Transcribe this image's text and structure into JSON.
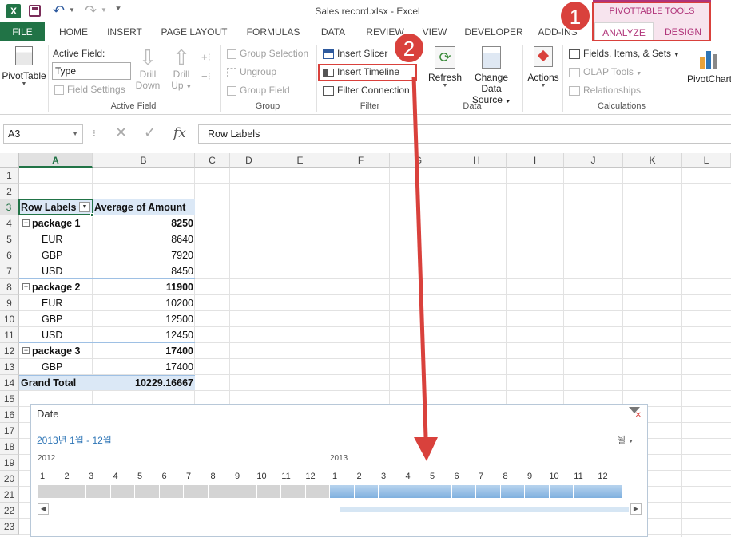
{
  "window": {
    "title": "Sales record.xlsx - Excel"
  },
  "context_tab_group": "PIVOTTABLE TOOLS",
  "tabs": [
    "FILE",
    "HOME",
    "INSERT",
    "PAGE LAYOUT",
    "FORMULAS",
    "DATA",
    "REVIEW",
    "VIEW",
    "DEVELOPER",
    "ADD-INS",
    "ANALYZE",
    "DESIGN"
  ],
  "ribbon": {
    "pivottable": {
      "label": "PivotTable"
    },
    "active_field": {
      "label": "Active Field:",
      "value": "Type",
      "field_settings": "Field Settings",
      "drill_down": [
        "Drill",
        "Down"
      ],
      "drill_up": [
        "Drill",
        "Up"
      ],
      "group_label": "Active Field"
    },
    "group": {
      "group_selection": "Group Selection",
      "ungroup": "Ungroup",
      "group_field": "Group Field",
      "group_label": "Group"
    },
    "filter": {
      "insert_slicer": "Insert Slicer",
      "insert_timeline": "Insert Timeline",
      "filter_connections": "Filter Connection",
      "group_label": "Filter"
    },
    "data": {
      "refresh": "Refresh",
      "change_source": [
        "Change Data",
        "Source"
      ],
      "group_label": "Data"
    },
    "actions": {
      "label": "Actions"
    },
    "calculations": {
      "fields_items": "Fields, Items, & Sets",
      "olap": "OLAP Tools",
      "relationships": "Relationships",
      "group_label": "Calculations"
    },
    "pivotchart": {
      "label": "PivotChart"
    }
  },
  "callouts": [
    "1",
    "2"
  ],
  "formula_bar": {
    "name_box": "A3",
    "fx": "fx",
    "content": "Row Labels"
  },
  "columns": [
    "A",
    "B",
    "C",
    "D",
    "E",
    "F",
    "G",
    "H",
    "I",
    "J",
    "K",
    "L"
  ],
  "rows": [
    "1",
    "2",
    "3",
    "4",
    "5",
    "6",
    "7",
    "8",
    "9",
    "10",
    "11",
    "12",
    "13",
    "14",
    "15",
    "16",
    "17",
    "18",
    "19",
    "20",
    "21",
    "22",
    "23"
  ],
  "pivot": {
    "header": {
      "labels": "Row Labels",
      "values": "Average of Amount"
    },
    "rows": [
      {
        "label": "package 1",
        "value": "8250",
        "level": 0
      },
      {
        "label": "EUR",
        "value": "8640",
        "level": 1
      },
      {
        "label": "GBP",
        "value": "7920",
        "level": 1
      },
      {
        "label": "USD",
        "value": "8450",
        "level": 1
      },
      {
        "label": "package 2",
        "value": "11900",
        "level": 0
      },
      {
        "label": "EUR",
        "value": "10200",
        "level": 1
      },
      {
        "label": "GBP",
        "value": "12500",
        "level": 1
      },
      {
        "label": "USD",
        "value": "12450",
        "level": 1
      },
      {
        "label": "package 3",
        "value": "17400",
        "level": 0
      },
      {
        "label": "GBP",
        "value": "17400",
        "level": 1
      }
    ],
    "grand_total": {
      "label": "Grand Total",
      "value": "10229.16667"
    }
  },
  "timeline": {
    "title": "Date",
    "range_label": "2013년 1월 - 12월",
    "period_selector": "월",
    "years": [
      "2012",
      "2013"
    ],
    "months": [
      "1",
      "2",
      "3",
      "4",
      "5",
      "6",
      "7",
      "8",
      "9",
      "10",
      "11",
      "12",
      "1",
      "2",
      "3",
      "4",
      "5",
      "6",
      "7",
      "8",
      "9",
      "10",
      "11",
      "12"
    ],
    "selected_from_index": 12,
    "colors": {
      "selected": "#9cc3e6",
      "unselected": "#d4d4d4",
      "accent": "#2e75b6"
    }
  },
  "colors": {
    "excel_green": "#217346",
    "callout_red": "#d9413c",
    "context_pink": "#f7e4ee",
    "context_text": "#b0347a"
  }
}
